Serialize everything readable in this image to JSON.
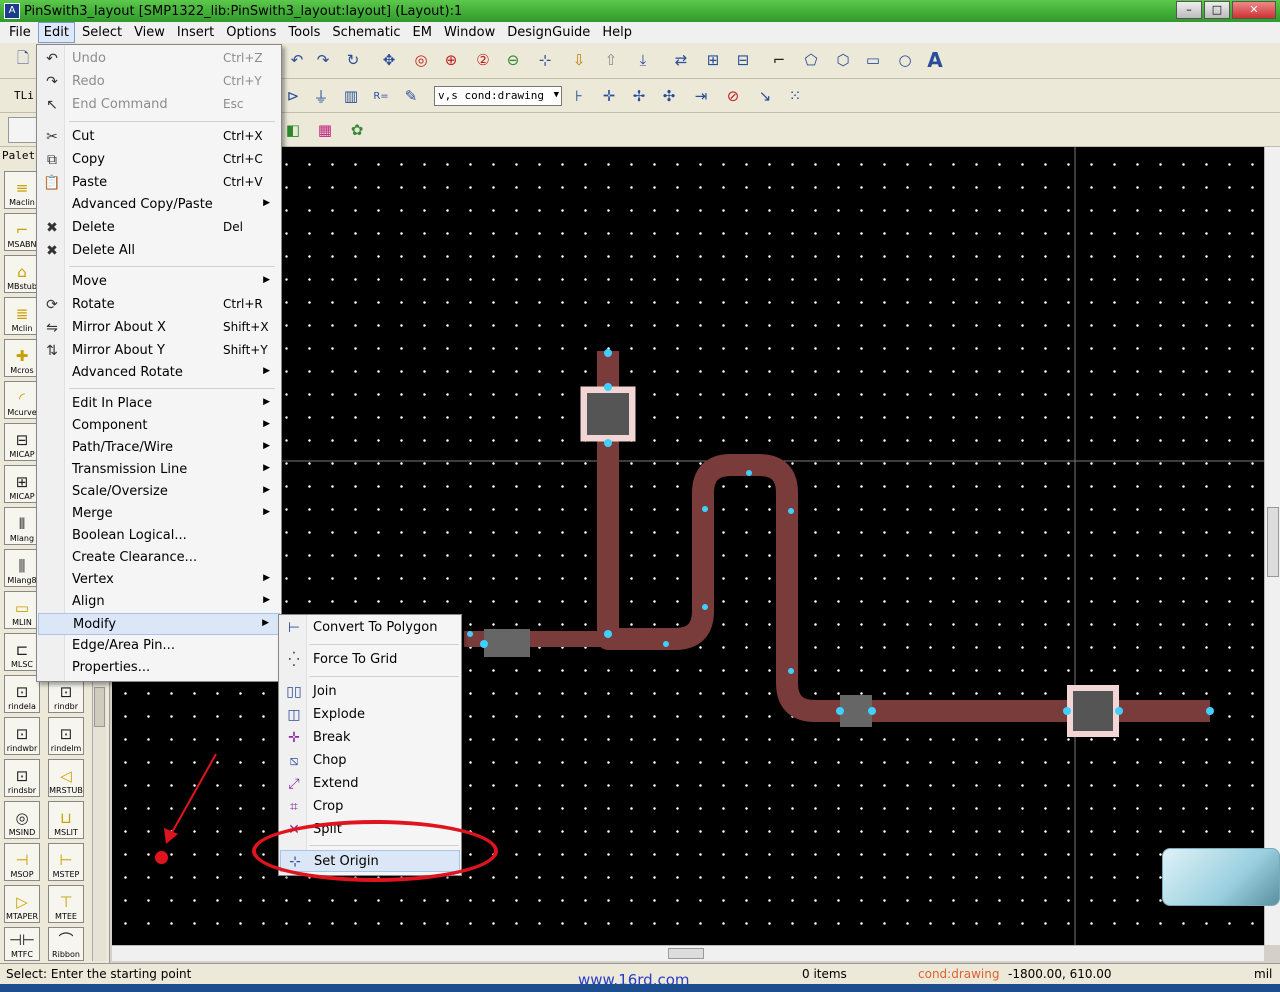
{
  "window": {
    "title": "PinSwith3_layout [SMP1322_lib:PinSwith3_layout:layout] (Layout):1",
    "controls": [
      "minimize",
      "maximize",
      "close"
    ]
  },
  "menubar": [
    "File",
    "Edit",
    "Select",
    "View",
    "Insert",
    "Options",
    "Tools",
    "Schematic",
    "EM",
    "Window",
    "DesignGuide",
    "Help"
  ],
  "toolbar": {
    "layer_field": "TLi",
    "layer_combo": "v,s cond:drawing"
  },
  "palette": {
    "title": "Palett",
    "items": [
      "Maclin",
      "MSABN",
      "MBstub",
      "Mclin",
      "Mcros",
      "Mcurve",
      "MICAP",
      "MICAP",
      "Mlang",
      "Mlang8",
      "MLIN",
      "MLSC",
      "rindela",
      "rindbr",
      "rindwbr",
      "rindelm",
      "rindsbr",
      "MRSTUB",
      "MSIND",
      "MSLIT",
      "MSOP",
      "MSTEP",
      "MTAPER",
      "MTEE",
      "MTFC",
      "Ribbon"
    ]
  },
  "edit_menu": {
    "items": [
      {
        "label": "Undo",
        "shortcut": "Ctrl+Z",
        "disabled": true,
        "icon": "undo-icon"
      },
      {
        "label": "Redo",
        "shortcut": "Ctrl+Y",
        "disabled": true,
        "icon": "redo-icon"
      },
      {
        "label": "End Command",
        "shortcut": "Esc",
        "disabled": true,
        "icon": "arrow-icon"
      },
      {
        "label": "Cut",
        "shortcut": "Ctrl+X",
        "icon": "scissors-icon"
      },
      {
        "label": "Copy",
        "shortcut": "Ctrl+C",
        "icon": "copy-icon"
      },
      {
        "label": "Paste",
        "shortcut": "Ctrl+V",
        "icon": "paste-icon"
      },
      {
        "label": "Advanced Copy/Paste",
        "submenu": true
      },
      {
        "label": "Delete",
        "shortcut": "Del",
        "icon": "delete-x-icon"
      },
      {
        "label": "Delete All",
        "icon": "delete-all-icon"
      },
      {
        "label": "Move",
        "submenu": true
      },
      {
        "label": "Rotate",
        "shortcut": "Ctrl+R",
        "icon": "rotate-icon"
      },
      {
        "label": "Mirror About X",
        "shortcut": "Shift+X",
        "icon": "mirror-x-icon"
      },
      {
        "label": "Mirror About Y",
        "shortcut": "Shift+Y",
        "icon": "mirror-y-icon"
      },
      {
        "label": "Advanced Rotate",
        "submenu": true
      },
      {
        "label": "Edit In Place",
        "submenu": true
      },
      {
        "label": "Component",
        "submenu": true
      },
      {
        "label": "Path/Trace/Wire",
        "submenu": true
      },
      {
        "label": "Transmission Line",
        "submenu": true
      },
      {
        "label": "Scale/Oversize",
        "submenu": true
      },
      {
        "label": "Merge",
        "submenu": true
      },
      {
        "label": "Boolean Logical..."
      },
      {
        "label": "Create Clearance..."
      },
      {
        "label": "Vertex",
        "submenu": true
      },
      {
        "label": "Align",
        "submenu": true
      },
      {
        "label": "Modify",
        "submenu": true,
        "highlight": true
      },
      {
        "label": "Edge/Area Pin..."
      },
      {
        "label": "Properties..."
      }
    ]
  },
  "modify_submenu": {
    "items": [
      {
        "label": "Convert To Polygon",
        "icon": "convert-polygon-icon"
      },
      {
        "label": "Force To Grid",
        "icon": "grid-snap-icon"
      },
      {
        "label": "Join",
        "icon": "join-icon"
      },
      {
        "label": "Explode",
        "icon": "explode-icon"
      },
      {
        "label": "Break",
        "icon": "break-icon"
      },
      {
        "label": "Chop",
        "icon": "chop-icon"
      },
      {
        "label": "Extend",
        "icon": "extend-icon"
      },
      {
        "label": "Crop",
        "icon": "crop-icon"
      },
      {
        "label": "Split",
        "icon": "split-icon"
      },
      {
        "label": "Set Origin",
        "icon": "set-origin-icon",
        "highlight": true
      }
    ]
  },
  "status": {
    "prompt": "Select: Enter the starting point",
    "items": "0 items",
    "layer": "cond:drawing",
    "coords": "-1800.00, 610.00",
    "units": "mil"
  },
  "watermark": "www.16rd.com",
  "colors": {
    "trace": "#7a3b3b",
    "pad": "#f2d6d6",
    "pin": "#3fd0ff",
    "annotation": "#e0141e"
  }
}
